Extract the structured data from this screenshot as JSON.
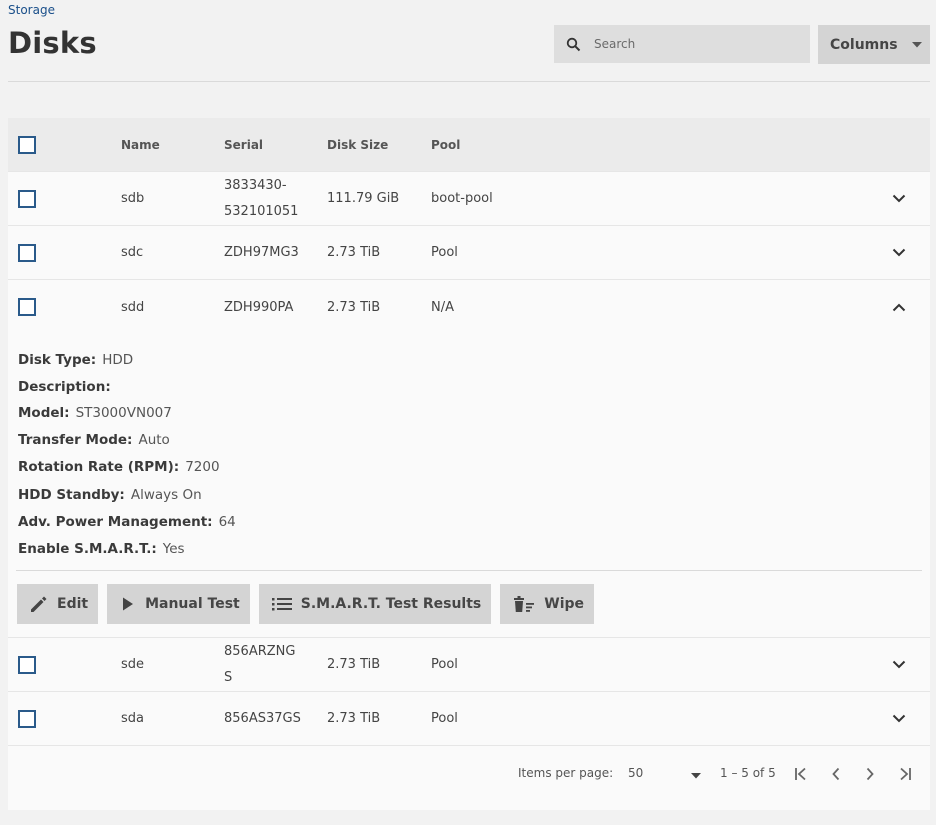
{
  "breadcrumb": "Storage",
  "title": "Disks",
  "search": {
    "placeholder": "Search"
  },
  "columns_button": "Columns",
  "table": {
    "headers": {
      "name": "Name",
      "serial": "Serial",
      "size": "Disk Size",
      "pool": "Pool"
    },
    "rows": [
      {
        "name": "sdb",
        "serial_l1": "3833430-",
        "serial_l2": "532101051",
        "size": "111.79 GiB",
        "pool": "boot-pool"
      },
      {
        "name": "sdc",
        "serial": "ZDH97MG3",
        "size": "2.73 TiB",
        "pool": "Pool"
      },
      {
        "name": "sdd",
        "serial": "ZDH990PA",
        "size": "2.73 TiB",
        "pool": "N/A"
      },
      {
        "name": "sde",
        "serial_l1": "856ARZNG",
        "serial_l2": "S",
        "size": "2.73 TiB",
        "pool": "Pool"
      },
      {
        "name": "sda",
        "serial": "856AS37GS",
        "size": "2.73 TiB",
        "pool": "Pool"
      }
    ]
  },
  "details": [
    {
      "label": "Disk Type:",
      "value": "HDD"
    },
    {
      "label": "Description:",
      "value": ""
    },
    {
      "label": "Model:",
      "value": "ST3000VN007"
    },
    {
      "label": "Transfer Mode:",
      "value": "Auto"
    },
    {
      "label": "Rotation Rate (RPM):",
      "value": "7200"
    },
    {
      "label": "HDD Standby:",
      "value": "Always On"
    },
    {
      "label": "Adv. Power Management:",
      "value": "64"
    },
    {
      "label": "Enable S.M.A.R.T.:",
      "value": "Yes"
    }
  ],
  "actions": {
    "edit": "Edit",
    "manual_test": "Manual Test",
    "smart_results": "S.M.A.R.T. Test Results",
    "wipe": "Wipe"
  },
  "paginator": {
    "items_label": "Items per page:",
    "page_size": "50",
    "range": "1 – 5 of 5"
  },
  "icons": {
    "search": "search-icon",
    "caret": "caret-down-icon",
    "expand": "chevron-down-icon",
    "collapse": "chevron-up-icon",
    "edit": "pencil-icon",
    "play": "play-icon",
    "list": "list-icon",
    "wipe": "trash-icon"
  }
}
